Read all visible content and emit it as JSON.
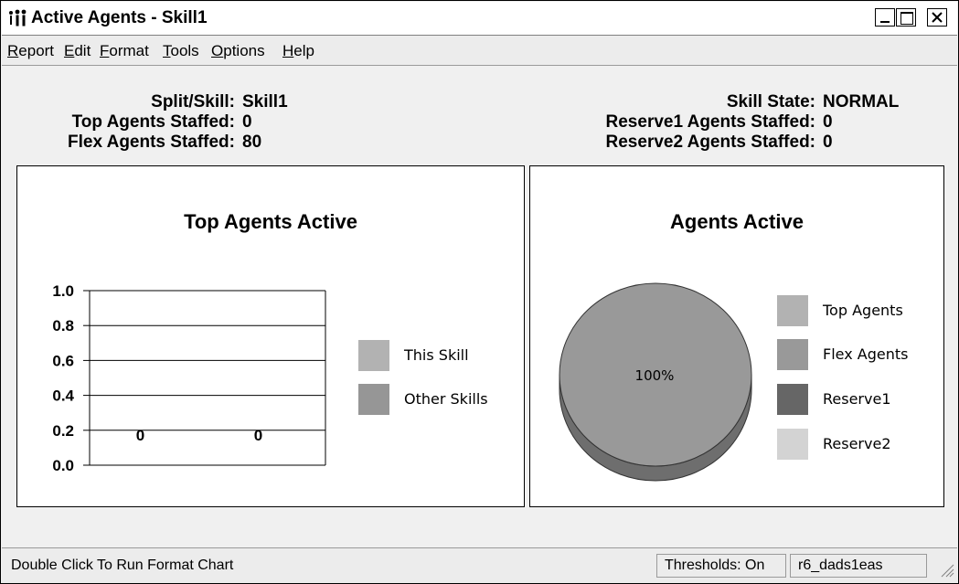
{
  "window": {
    "title": "Active Agents - Skill1",
    "controls": {
      "minimize": "_",
      "maximize": "□",
      "close": "×"
    }
  },
  "menu": {
    "items": [
      {
        "key": "R",
        "rest": "eport"
      },
      {
        "key": "E",
        "rest": "dit"
      },
      {
        "key": "F",
        "rest": "ormat"
      },
      {
        "key": "T",
        "rest": "ools"
      },
      {
        "key": "O",
        "rest": "ptions"
      },
      {
        "key": "H",
        "rest": "elp"
      }
    ]
  },
  "summary": {
    "left": [
      {
        "label": "Split/Skill:",
        "value": "Skill1"
      },
      {
        "label": "Top Agents Staffed:",
        "value": "0"
      },
      {
        "label": "Flex Agents Staffed:",
        "value": "80"
      }
    ],
    "right": [
      {
        "label": "Skill State:",
        "value": "NORMAL"
      },
      {
        "label": "Reserve1 Agents Staffed:",
        "value": "0"
      },
      {
        "label": "Reserve2 Agents Staffed:",
        "value": "0"
      }
    ]
  },
  "chart_data": [
    {
      "type": "bar",
      "title": "Top Agents Active",
      "categories": [
        "",
        ""
      ],
      "series": [
        {
          "name": "This Skill",
          "values": [
            0,
            0
          ],
          "color": "#b2b2b2"
        },
        {
          "name": "Other Skills",
          "values": [
            0,
            0
          ],
          "color": "#969696"
        }
      ],
      "data_labels": [
        "0",
        "0"
      ],
      "yticks": [
        "0.0",
        "0.2",
        "0.4",
        "0.6",
        "0.8",
        "1.0"
      ],
      "ylim": [
        0,
        1.0
      ],
      "grid": true,
      "legend": "right"
    },
    {
      "type": "pie",
      "title": "Agents Active",
      "slices": [
        {
          "name": "Top Agents",
          "value": 0,
          "color": "#b2b2b2"
        },
        {
          "name": "Flex Agents",
          "value": 100,
          "color": "#999999",
          "label": "100%"
        },
        {
          "name": "Reserve1",
          "value": 0,
          "color": "#666666"
        },
        {
          "name": "Reserve2",
          "value": 0,
          "color": "#d3d3d3"
        }
      ],
      "legend": "right"
    }
  ],
  "status": {
    "message": "Double Click To Run Format Chart",
    "thresholds": "Thresholds: On",
    "server": "r6_dads1eas"
  }
}
